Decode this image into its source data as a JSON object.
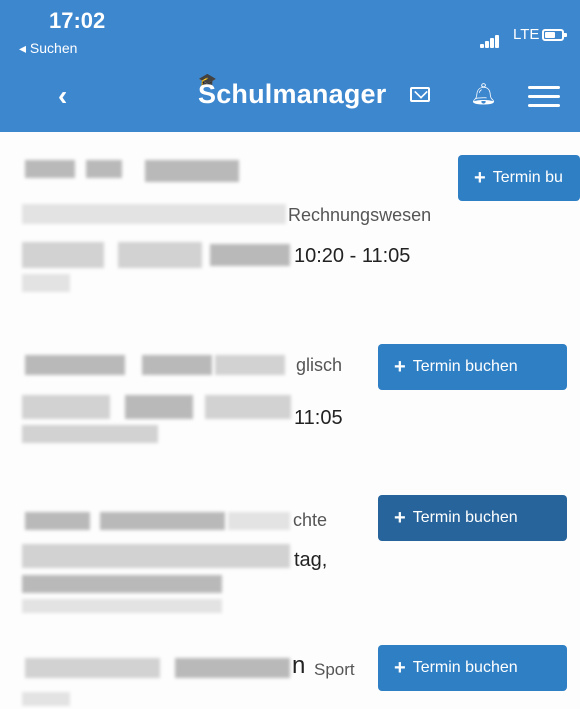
{
  "status_bar": {
    "time": "17:02",
    "back_app": "◂ Suchen",
    "network": "LTE"
  },
  "nav": {
    "back": "‹",
    "brand": "Schulmanager",
    "icons": [
      "mail-icon",
      "bell-icon",
      "menu-icon"
    ]
  },
  "cards": [
    {
      "visible_fragment": "Rechnungswesen",
      "time_fragment": "10:20 - 11:05",
      "button_label": "Termin bu"
    },
    {
      "visible_fragment": "glisch",
      "time_fragment": "11:05",
      "button_label": "Termin buchen"
    },
    {
      "visible_fragment": "chte",
      "time_fragment": "tag,",
      "button_label": "Termin buchen"
    },
    {
      "visible_fragment_large": "n",
      "visible_fragment": "Sport",
      "button_label": "Termin buchen"
    }
  ],
  "colors": {
    "header": "#3d87cf",
    "button": "#2f7fc4",
    "button_active": "#26649b"
  }
}
